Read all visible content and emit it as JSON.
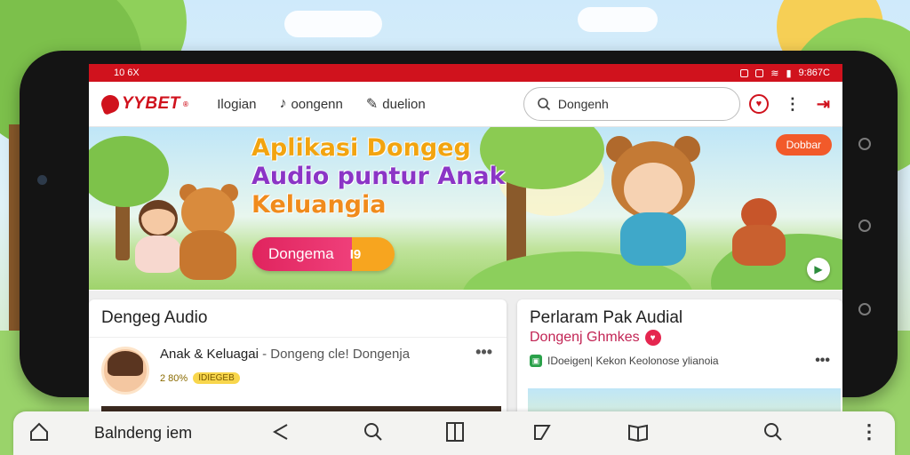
{
  "status_bar": {
    "left": "10 6X",
    "right": "9:867C"
  },
  "app": {
    "logo_text": "YYBET",
    "logo_mark": "®",
    "nav": [
      {
        "label": "Ilogian",
        "icon": ""
      },
      {
        "label": "oongenn",
        "icon": "note-icon"
      },
      {
        "label": "duelion",
        "icon": "speech-icon"
      }
    ],
    "search": {
      "value": "Dongenh",
      "icon": "search-icon"
    }
  },
  "hero": {
    "title_line1": "Aplikasi Dongeg",
    "title_line2": "Audio puntur Anak",
    "title_line3": "Keluangia",
    "cta_label": "Dongema",
    "cta_badge": "I9",
    "tag": "Dobbar",
    "play_icon": "play-icon"
  },
  "left_card": {
    "title": "Dengeg Audio",
    "episode": {
      "title": "Anak & Keluagai",
      "subtitle": "- Dongeng cle! Dongenja",
      "meta": "2 80%",
      "pill": "IDIEGEB",
      "more": "•••"
    }
  },
  "right_card": {
    "title": "Perlaram Pak Audial",
    "subtitle": "Dongenj Ghmkes",
    "line": "IDoeigen| Kekon Keolonose ylianoia",
    "more": "•••"
  },
  "bottom_bar": {
    "label": "Balndeng iem",
    "sublabel": "..."
  },
  "colors": {
    "brand_red": "#d0121d",
    "cta_pink": "#e0245e",
    "cta_orange": "#f7a51f",
    "title_yellow": "#f2a40f",
    "title_purple": "#8b35c6"
  }
}
